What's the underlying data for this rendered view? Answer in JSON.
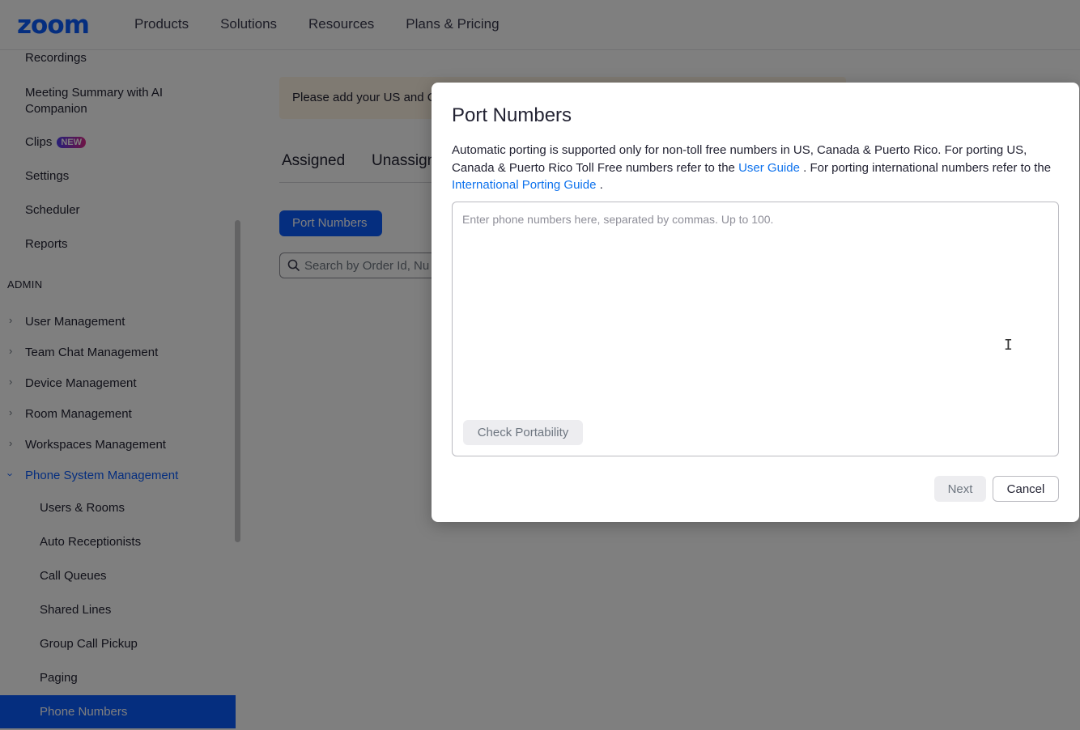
{
  "header": {
    "logo": "zoom",
    "nav": [
      "Products",
      "Solutions",
      "Resources",
      "Plans & Pricing"
    ]
  },
  "sidebar": {
    "items_top": [
      "Recordings",
      "Meeting Summary with AI Companion",
      "Clips",
      "Settings",
      "Scheduler",
      "Reports"
    ],
    "clips_badge": "NEW",
    "admin_label": "ADMIN",
    "groups": [
      "User Management",
      "Team Chat Management",
      "Device Management",
      "Room Management",
      "Workspaces Management",
      "Phone System Management"
    ],
    "phone_sub_items": [
      "Users & Rooms",
      "Auto Receptionists",
      "Call Queues",
      "Shared Lines",
      "Group Call Pickup",
      "Paging",
      "Phone Numbers"
    ],
    "active_item": "Phone Numbers"
  },
  "main": {
    "banner_text": "Please add your US and C",
    "tabs": [
      "Assigned",
      "Unassign"
    ],
    "port_button": "Port Numbers",
    "search_placeholder": "Search by Order Id, Nu"
  },
  "modal": {
    "title": "Port Numbers",
    "desc_part1": "Automatic porting is supported only for non-toll free numbers in US, Canada & Puerto Rico. For porting US, Canada & Puerto Rico Toll Free numbers refer to the ",
    "link_user_guide": "User Guide",
    "desc_part2": " . For porting international numbers refer to the ",
    "link_intl_guide": "International Porting Guide",
    "desc_part3": " .",
    "textarea_placeholder": "Enter phone numbers here, separated by commas. Up to 100.",
    "check_button": "Check Portability",
    "next_button": "Next",
    "cancel_button": "Cancel"
  },
  "colors": {
    "brand": "#0b5cff",
    "link": "#0e72ed"
  }
}
